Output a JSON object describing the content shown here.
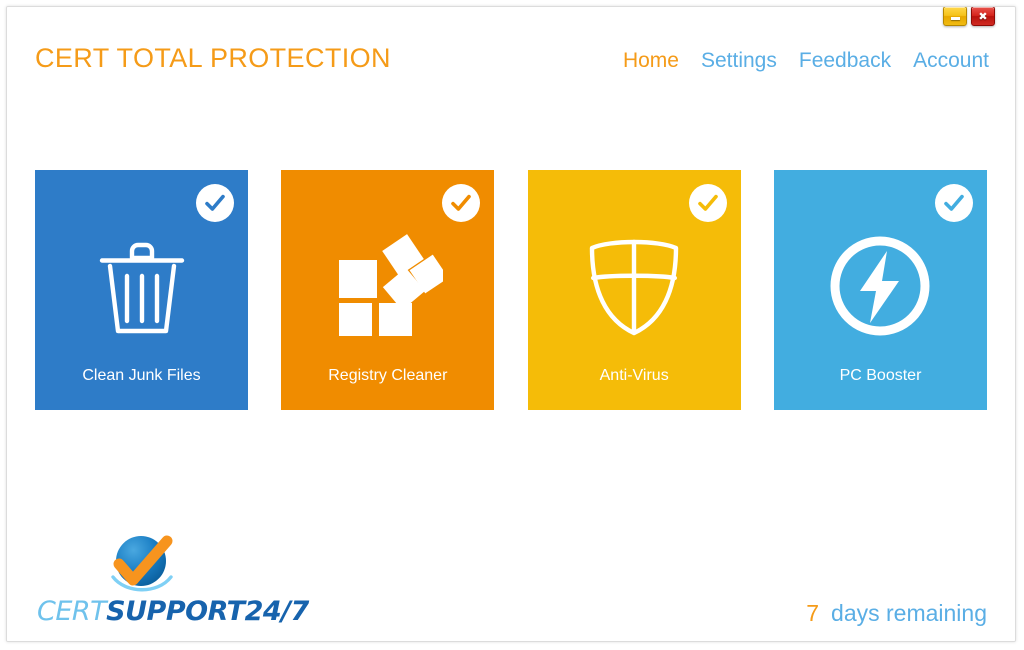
{
  "window": {
    "controls": [
      {
        "name": "minimize",
        "label": "Minimize",
        "glyph": "",
        "color": "#f5c21a"
      },
      {
        "name": "close",
        "label": "Close",
        "glyph": "✖",
        "color": "#d6241c"
      }
    ]
  },
  "header": {
    "title": "CERT TOTAL PROTECTION",
    "title_color": "#f59b18",
    "nav": [
      {
        "label": "Home",
        "active": true,
        "color": "#f59b18"
      },
      {
        "label": "Settings",
        "active": false,
        "color": "#5aaee5"
      },
      {
        "label": "Feedback",
        "active": false,
        "color": "#5aaee5"
      },
      {
        "label": "Account",
        "active": false,
        "color": "#5aaee5"
      }
    ]
  },
  "main": {
    "tiles": [
      {
        "label": "Clean Junk Files",
        "icon": "trash-can-icon",
        "color": "#2e7cc8",
        "checked": true
      },
      {
        "label": "Registry Cleaner",
        "icon": "registry-blocks-icon",
        "color": "#f08c00",
        "checked": true
      },
      {
        "label": "Anti-Virus",
        "icon": "shield-icon",
        "color": "#f5bc08",
        "checked": true
      },
      {
        "label": "PC Booster",
        "icon": "lightning-bolt-circle-icon",
        "color": "#42ade0",
        "checked": true
      }
    ]
  },
  "footer": {
    "logo": {
      "mark": "blue-sphere-orange-check-icon",
      "wordmark_part1": "CERT",
      "wordmark_part2": "SUPPORT",
      "wordmark_part3": "24/7",
      "part1_color": "#6fc2ec",
      "part2_color": "#1763ad"
    },
    "trial": {
      "days": "7",
      "label": "days remaining",
      "days_color": "#f59b18",
      "label_color": "#5aaee5"
    }
  }
}
